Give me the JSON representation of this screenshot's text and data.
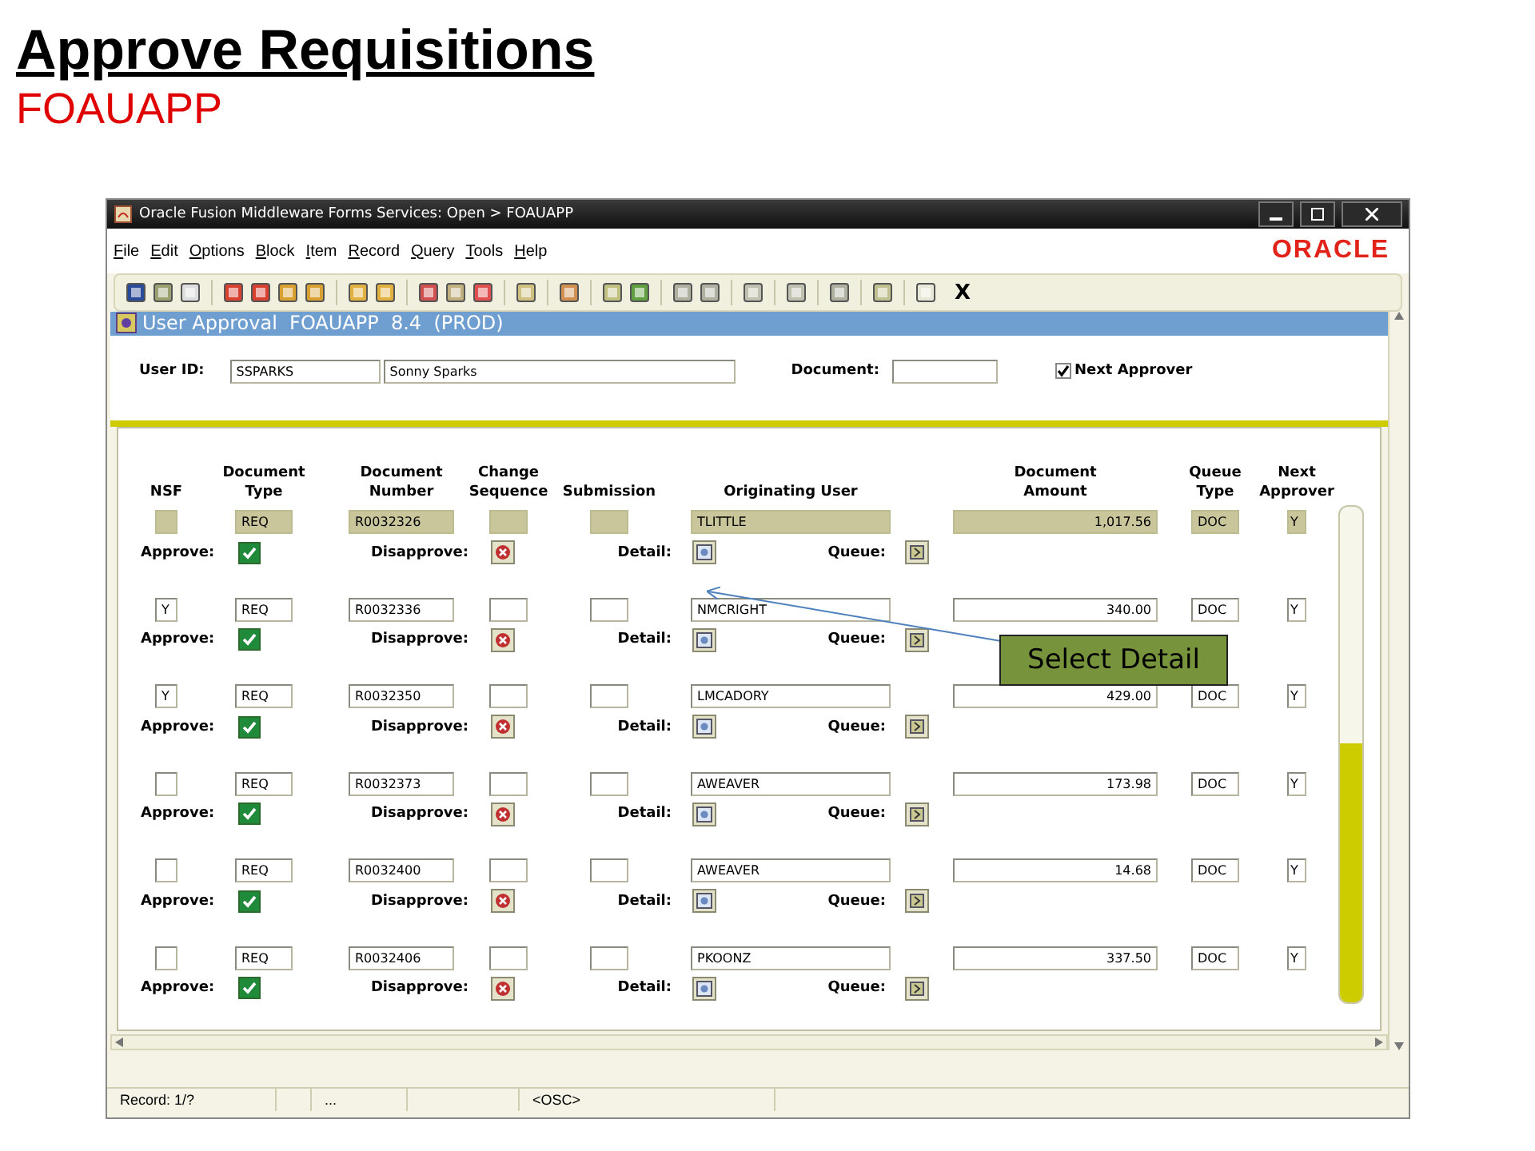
{
  "slide": {
    "title": "Approve Requisitions",
    "subtitle": "FOAUAPP"
  },
  "window": {
    "title": "Oracle Fusion Middleware Forms Services: Open > FOAUAPP",
    "logo": "ORACLE",
    "toolbar_exit": "X"
  },
  "menu": [
    "File",
    "Edit",
    "Options",
    "Block",
    "Item",
    "Record",
    "Query",
    "Tools",
    "Help"
  ],
  "form": {
    "title": "User Approval  FOAUAPP  8.4  (PROD)",
    "user_id_label": "User ID:",
    "user_id": "SSPARKS",
    "user_name": "Sonny Sparks",
    "document_label": "Document:",
    "next_approver": {
      "label": "Next Approver",
      "checked": true
    }
  },
  "columns": [
    [
      "NSF"
    ],
    [
      "Document",
      "Type"
    ],
    [
      "Document",
      "Number"
    ],
    [
      "Change",
      "Sequence"
    ],
    [
      "Submission"
    ],
    [
      "Originating User"
    ],
    [
      "Document",
      "Amount"
    ],
    [
      "Queue",
      "Type"
    ],
    [
      "Next",
      "Approver"
    ]
  ],
  "rows": [
    {
      "selected": true,
      "nsf": "",
      "doc_type": "REQ",
      "doc_number": "R0032326",
      "user": "TLITTLE",
      "amount": "1,017.56",
      "queue_type": "DOC",
      "next": "Y",
      "approve": true,
      "labels": [
        "Approve:",
        "Disapprove:",
        "Detail:",
        "Queue:"
      ]
    },
    {
      "selected": false,
      "nsf": "Y",
      "doc_type": "REQ",
      "doc_number": "R0032336",
      "user": "NMCRIGHT",
      "amount": "340.00",
      "queue_type": "DOC",
      "next": "Y",
      "approve": true,
      "labels": [
        "Approve:",
        "Disapprove:",
        "Detail:",
        "Queue:"
      ]
    },
    {
      "selected": false,
      "nsf": "Y",
      "doc_type": "REQ",
      "doc_number": "R0032350",
      "user": "LMCADORY",
      "amount": "429.00",
      "queue_type": "DOC",
      "next": "Y",
      "approve": true,
      "labels": [
        "Approve:",
        "Disapprove:",
        "Detail:",
        "Queue:"
      ]
    },
    {
      "selected": false,
      "nsf": "",
      "doc_type": "REQ",
      "doc_number": "R0032373",
      "user": "AWEAVER",
      "amount": "173.98",
      "queue_type": "DOC",
      "next": "Y",
      "approve": true,
      "labels": [
        "Approve:",
        "Disapprove:",
        "Detail:",
        "Queue:"
      ]
    },
    {
      "selected": false,
      "nsf": "",
      "doc_type": "REQ",
      "doc_number": "R0032400",
      "user": "AWEAVER",
      "amount": "14.68",
      "queue_type": "DOC",
      "next": "Y",
      "approve": true,
      "labels": [
        "Approve:",
        "Disapprove:",
        "Detail:",
        "Queue:"
      ]
    },
    {
      "selected": false,
      "nsf": "",
      "doc_type": "REQ",
      "doc_number": "R0032406",
      "user": "PKOONZ",
      "amount": "337.50",
      "queue_type": "DOC",
      "next": "Y",
      "approve": true,
      "labels": [
        "Approve:",
        "Disapprove:",
        "Detail:",
        "Queue:"
      ]
    }
  ],
  "status_bar": [
    "Record: 1/?",
    "...",
    "<OSC>"
  ],
  "callout": "Select Detail"
}
